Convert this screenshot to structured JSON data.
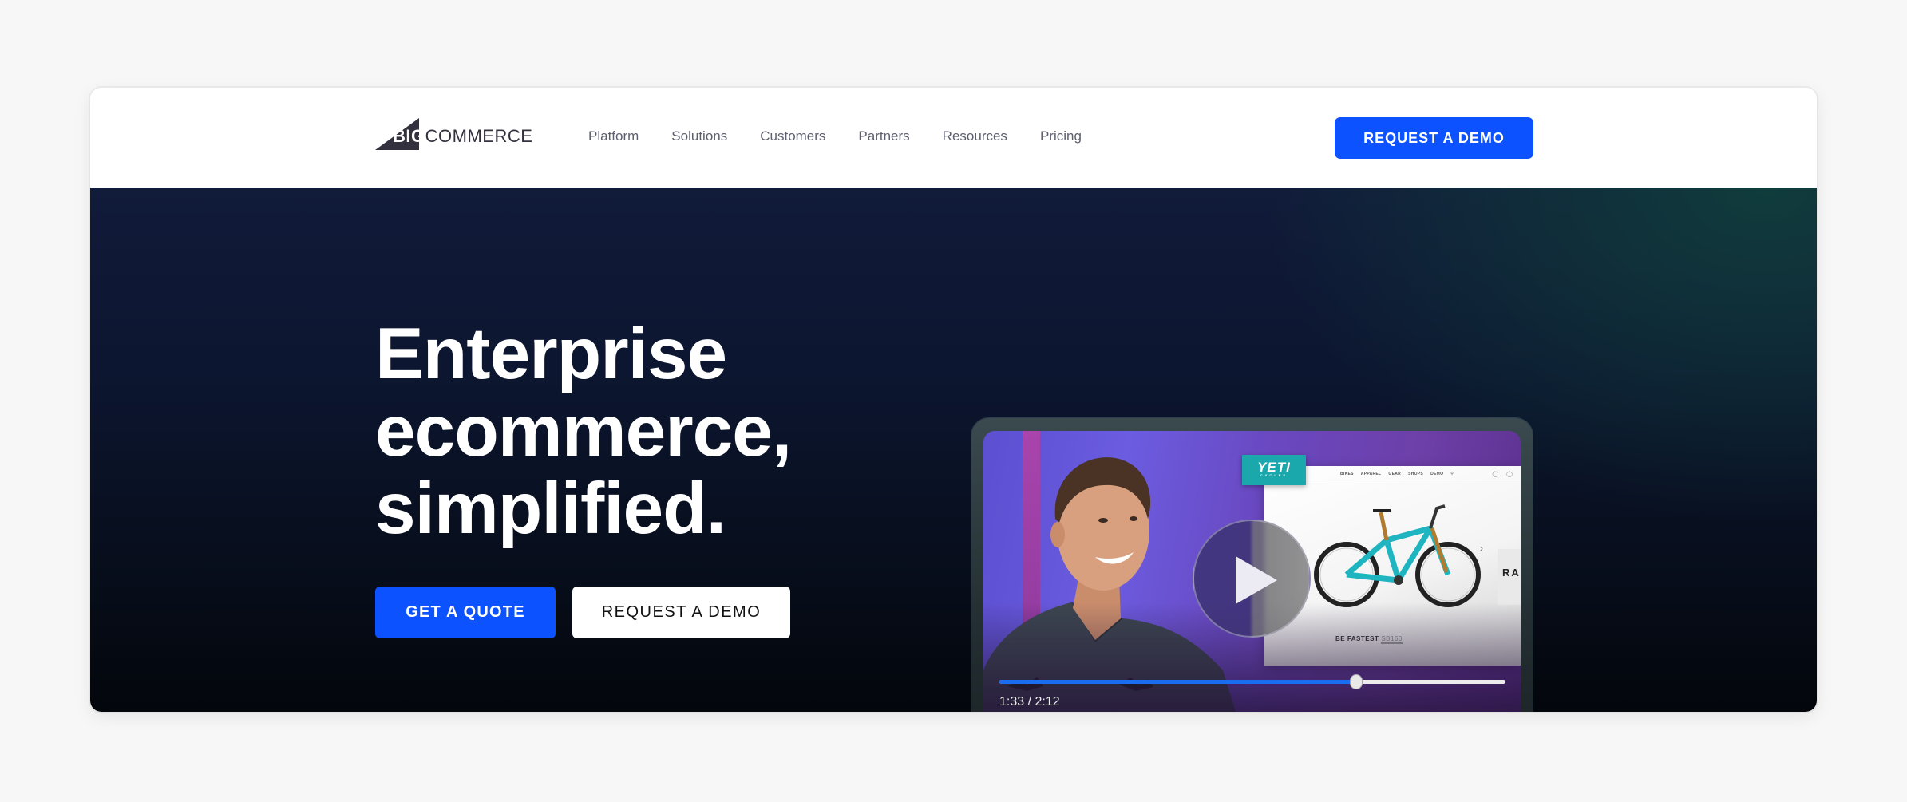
{
  "header": {
    "logo": {
      "big": "BIG",
      "commerce": "COMMERCE"
    },
    "nav": [
      {
        "label": "Platform"
      },
      {
        "label": "Solutions"
      },
      {
        "label": "Customers"
      },
      {
        "label": "Partners"
      },
      {
        "label": "Resources"
      },
      {
        "label": "Pricing"
      }
    ],
    "cta_label": "REQUEST A DEMO"
  },
  "hero": {
    "title_lines": [
      "Enterprise",
      "ecommerce,",
      "simplified."
    ],
    "primary_button": "GET A QUOTE",
    "secondary_button": "REQUEST A DEMO"
  },
  "video": {
    "current_time": "1:33",
    "duration": "2:12",
    "time_label": "1:33 / 2:12",
    "progress_fraction": 0.705,
    "play_icon": "play-icon",
    "mockup": {
      "brand": "YETI",
      "brand_sub": "CYCLES",
      "nav_items": [
        "BIKES",
        "APPAREL",
        "GEAR",
        "SHOPS",
        "DEMO"
      ],
      "caption": "BE FASTEST",
      "model": "SB160",
      "side_text": "RA"
    }
  },
  "colors": {
    "accent": "#0d52ff",
    "nav_text": "#5e5f6d",
    "logo": "#34313f",
    "progress": "#1a6cf0",
    "yeti_teal": "#1aa8ac"
  }
}
